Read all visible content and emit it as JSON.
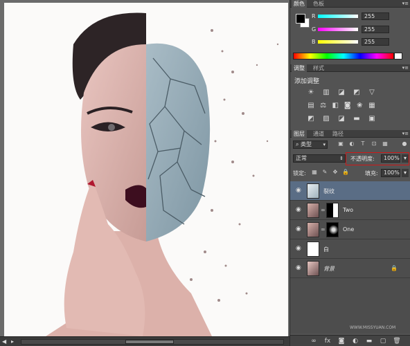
{
  "color_panel": {
    "tabs": [
      "颜色",
      "色板"
    ],
    "channels": [
      {
        "label": "R",
        "value": "255"
      },
      {
        "label": "G",
        "value": "255"
      },
      {
        "label": "B",
        "value": "255"
      }
    ],
    "foreground": "#000000",
    "background": "#ffffff"
  },
  "adjust_panel": {
    "tabs": [
      "调整",
      "样式"
    ],
    "title": "添加调整"
  },
  "layers_panel": {
    "tabs": [
      "图层",
      "通道",
      "路径"
    ],
    "kind_label": "类型",
    "blend_mode": "正常",
    "opacity_label": "不透明度:",
    "opacity_value": "100%",
    "lock_label": "锁定:",
    "fill_label": "填充:",
    "fill_value": "100%",
    "layers": [
      {
        "name": "裂纹",
        "selected": true
      },
      {
        "name": "Two"
      },
      {
        "name": "One"
      },
      {
        "name": "白"
      },
      {
        "name": "背景"
      }
    ]
  },
  "icons": {
    "eye": "eye-icon",
    "chain": "link-icon",
    "lock": "lock-icon"
  },
  "watermark": "WWW.MISSYUAN.COM"
}
